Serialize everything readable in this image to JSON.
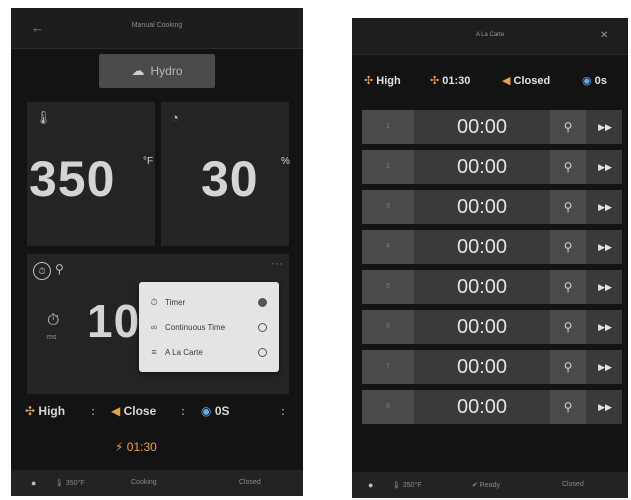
{
  "left": {
    "header": {
      "back_icon": "arrow-left-icon",
      "back": "←",
      "title": "Manual Cooking"
    },
    "mode_button": {
      "icon": "steam-cloud-icon",
      "icon_glyph": "☁",
      "label": "Hydro"
    },
    "temperature": {
      "icon": "thermometer-icon",
      "icon_glyph": "🌡",
      "value": "350",
      "unit": "°F"
    },
    "humidity": {
      "icon": "humidity-icon",
      "icon_glyph": "◔",
      "value": "30",
      "unit": "%"
    },
    "timer": {
      "stopwatch_glyph": "⏱",
      "wrench_glyph": "⚲",
      "dots": "···",
      "clock_glyph": "⏱",
      "mode_text": "ms",
      "value": "10"
    },
    "mode_menu": {
      "items": [
        {
          "icon": "stopwatch-icon",
          "glyph": "⏱",
          "label": "Timer",
          "selected": true
        },
        {
          "icon": "infinity-icon",
          "glyph": "∞",
          "label": "Continuous Time",
          "selected": false
        },
        {
          "icon": "a-la-carte-icon",
          "glyph": "≡",
          "label": "A La Carte",
          "selected": false
        }
      ]
    },
    "status": {
      "fan_glyph": "✣",
      "fan": "High",
      "colon": ":",
      "damper_glyph": "◀",
      "damper": "Close",
      "steam_glyph": "◉",
      "steam": "0S"
    },
    "cook_time": {
      "glyph": "⚡",
      "value": "01:30"
    },
    "footer": {
      "dot": "●",
      "temp": "🌡 350°F",
      "status": "Cooking",
      "door": "Closed"
    }
  },
  "right": {
    "header": {
      "title": "A La Carte",
      "close": "✕"
    },
    "status": {
      "fan_glyph": "✣",
      "fan": "High",
      "time_glyph": "✣",
      "time": "01:30",
      "damper_glyph": "◀",
      "damper": "Closed",
      "steam_glyph": "◉",
      "steam": "0s"
    },
    "slots": [
      {
        "num": "1",
        "time": "00:00",
        "wrench": "⚲",
        "skip": "▶▶"
      },
      {
        "num": "2",
        "time": "00:00",
        "wrench": "⚲",
        "skip": "▶▶"
      },
      {
        "num": "3",
        "time": "00:00",
        "wrench": "⚲",
        "skip": "▶▶"
      },
      {
        "num": "4",
        "time": "00:00",
        "wrench": "⚲",
        "skip": "▶▶"
      },
      {
        "num": "5",
        "time": "00:00",
        "wrench": "⚲",
        "skip": "▶▶"
      },
      {
        "num": "6",
        "time": "00:00",
        "wrench": "⚲",
        "skip": "▶▶"
      },
      {
        "num": "7",
        "time": "00:00",
        "wrench": "⚲",
        "skip": "▶▶"
      },
      {
        "num": "8",
        "time": "00:00",
        "wrench": "⚲",
        "skip": "▶▶"
      }
    ],
    "footer": {
      "dot": "●",
      "temp": "🌡 350°F",
      "ready": "✔ Ready",
      "door": "Closed"
    }
  },
  "colors": {
    "accent_orange": "#e8a04a",
    "accent_blue": "#6aa8e8",
    "panel": "#242424",
    "background": "#131313"
  }
}
